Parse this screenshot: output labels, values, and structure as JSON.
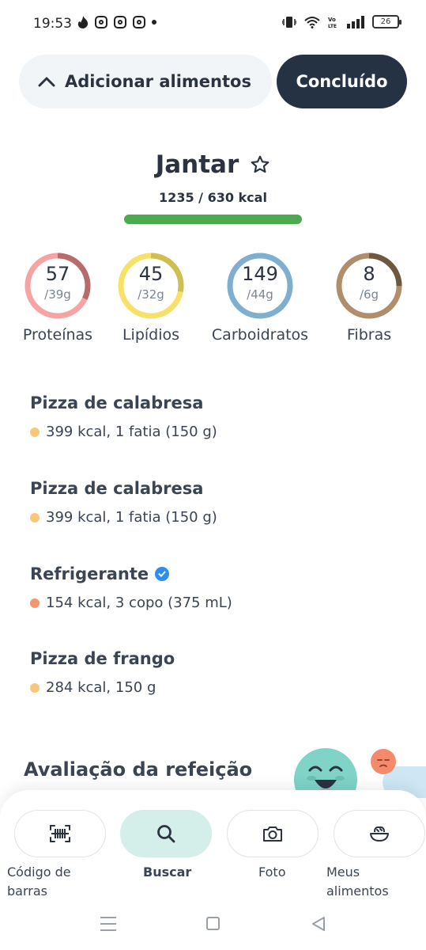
{
  "status_bar": {
    "time": "19:53",
    "battery": "26",
    "icons": [
      "tinder-icon",
      "instagram-icon",
      "instagram-icon",
      "instagram-icon",
      "dot-icon",
      "vibrate-icon",
      "wifi-icon",
      "volte-icon",
      "signal-icon",
      "battery-icon"
    ]
  },
  "header": {
    "add_foods_label": "Adicionar alimentos",
    "done_label": "Concluído"
  },
  "meal": {
    "title": "Jantar",
    "kcal_text": "1235 / 630 kcal",
    "kcal_progress": 1.0,
    "colors": {
      "bar": "#4caa4f",
      "bar_track": "#7dd17d"
    }
  },
  "macros": [
    {
      "value": "57",
      "goal": "/39g",
      "name": "Proteínas",
      "color": "#f5a3a3",
      "dark": "#b86b6b",
      "progress": 0.68
    },
    {
      "value": "45",
      "goal": "/32g",
      "name": "Lipídios",
      "color": "#f8e169",
      "dark": "#cfbe52",
      "progress": 0.72
    },
    {
      "value": "149",
      "goal": "/44g",
      "name": "Carboidratos",
      "color": "#7eaed0",
      "dark": "#7eaed0",
      "progress": 1.0
    },
    {
      "value": "8",
      "goal": "/6g",
      "name": "Fibras",
      "color": "#b08e6c",
      "dark": "#6f5840",
      "progress": 0.75
    }
  ],
  "foods": [
    {
      "name": "Pizza de calabresa",
      "desc": "399 kcal, 1 fatia (150 g)",
      "dot_color": "#f9c77c",
      "verified": false
    },
    {
      "name": "Pizza de calabresa",
      "desc": "399 kcal, 1 fatia (150 g)",
      "dot_color": "#f9c77c",
      "verified": false
    },
    {
      "name": "Refrigerante",
      "desc": "154 kcal, 3 copo (375 mL)",
      "dot_color": "#f0976c",
      "verified": true
    },
    {
      "name": "Pizza de frango",
      "desc": "284 kcal, 150 g",
      "dot_color": "#f9c77c",
      "verified": false
    }
  ],
  "rating": {
    "title": "Avaliação da refeição"
  },
  "bottom_tabs": [
    {
      "label": "Código de barras",
      "icon": "barcode-icon",
      "active": false
    },
    {
      "label": "Buscar",
      "icon": "search-icon",
      "active": true
    },
    {
      "label": "Foto",
      "icon": "camera-icon",
      "active": false
    },
    {
      "label": "Meus alimentos",
      "icon": "bowl-icon",
      "active": false
    }
  ]
}
